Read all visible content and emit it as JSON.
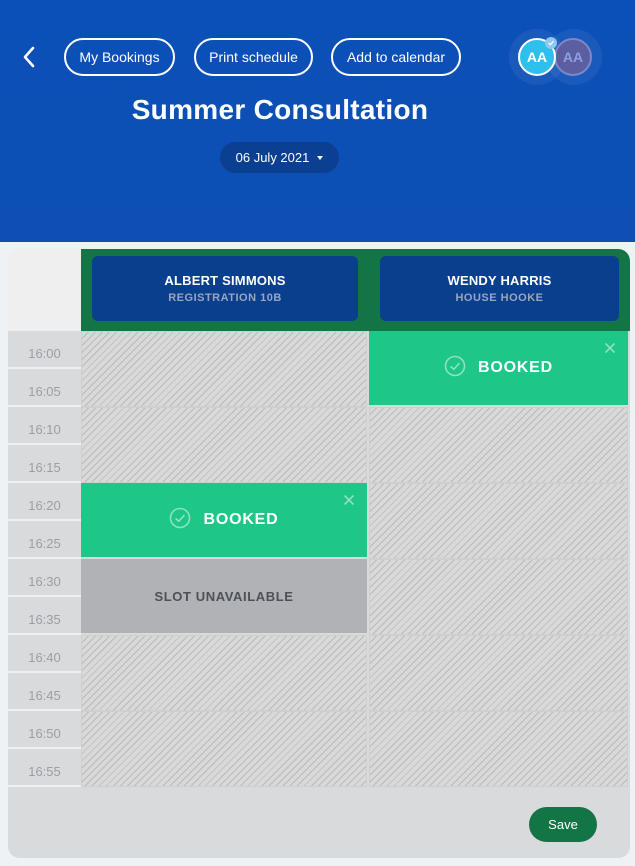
{
  "header": {
    "back_icon": "chevron-left-icon",
    "buttons": {
      "my_bookings": "My Bookings",
      "print_schedule": "Print schedule",
      "add_to_calendar": "Add to calendar"
    },
    "avatars": [
      {
        "initials": "AA",
        "selected": true,
        "color": "#2fbfec"
      },
      {
        "initials": "AA",
        "selected": false,
        "color": "#5b5ea0"
      }
    ],
    "title": "Summer Consultation",
    "date": "06 July 2021"
  },
  "columns": [
    {
      "name": "ALBERT SIMMONS",
      "subtitle": "REGISTRATION 10B"
    },
    {
      "name": "WENDY HARRIS",
      "subtitle": "HOUSE HOOKE"
    }
  ],
  "times": [
    "16:00",
    "16:05",
    "16:10",
    "16:15",
    "16:20",
    "16:25",
    "16:30",
    "16:35",
    "16:40",
    "16:45",
    "16:50",
    "16:55"
  ],
  "slots": {
    "booked_label": "BOOKED",
    "unavailable_label": "SLOT UNAVAILABLE",
    "items": [
      {
        "column": "WENDY HARRIS",
        "start": "16:00",
        "end": "16:10",
        "status": "booked"
      },
      {
        "column": "ALBERT SIMMONS",
        "start": "16:20",
        "end": "16:30",
        "status": "booked"
      },
      {
        "column": "ALBERT SIMMONS",
        "start": "16:30",
        "end": "16:40",
        "status": "unavailable"
      }
    ]
  },
  "colors": {
    "header_bg": "#0b50b8",
    "column_header_bg": "#137446",
    "column_card_bg": "#0a3f8e",
    "booked": "#1ec688",
    "unavailable": "#b1b2b5",
    "save": "#137446"
  },
  "footer": {
    "save_label": "Save"
  }
}
